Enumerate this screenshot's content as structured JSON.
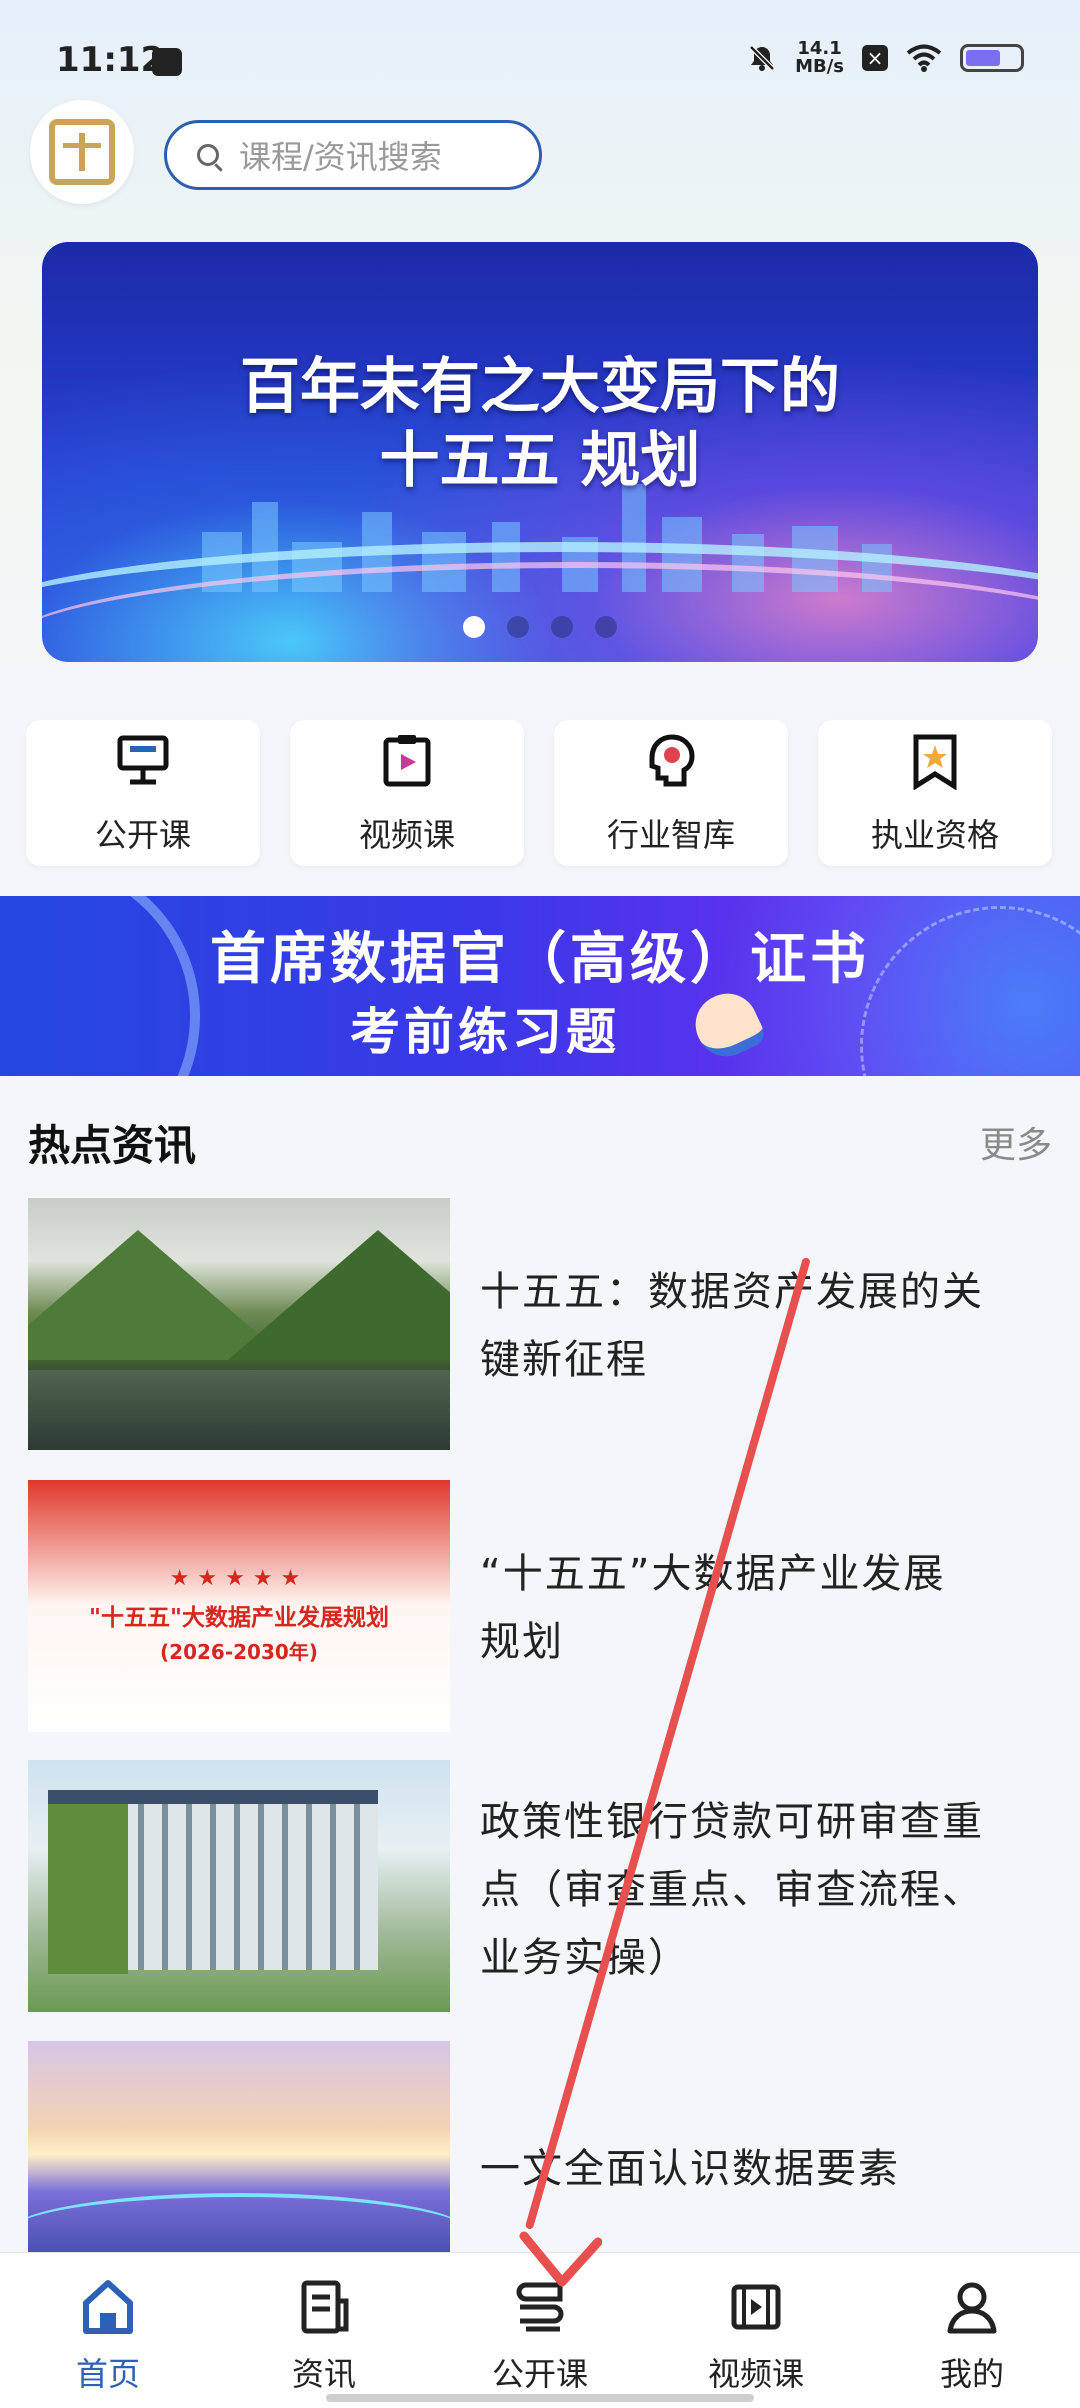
{
  "status_bar": {
    "time": "11:12",
    "net_speed_value": "14.1",
    "net_speed_unit": "MB/s"
  },
  "header": {
    "search_placeholder": "课程/资讯搜索"
  },
  "banner": {
    "line1": "百年未有之大变局下的",
    "line2": "十五五 规划",
    "dots": 4,
    "active_dot": 0
  },
  "categories": [
    {
      "label": "公开课",
      "icon": "monitor-icon"
    },
    {
      "label": "视频课",
      "icon": "video-clipboard-icon"
    },
    {
      "label": "行业智库",
      "icon": "brain-head-icon"
    },
    {
      "label": "执业资格",
      "icon": "star-bookmark-icon"
    }
  ],
  "promo": {
    "title": "首席数据官（高级）证书",
    "subtitle": "考前练习题"
  },
  "news_section": {
    "title": "热点资讯",
    "more": "更多",
    "items": [
      {
        "title_line1": "十五五：数据资产发展的关",
        "title_line2": "键新征程"
      },
      {
        "title_line1": "“十五五”大数据产业发展",
        "title_line2": "规划",
        "thumb_stars": "★★★★★",
        "thumb_text1": "\"十五五\"大数据产业发展规划",
        "thumb_text2": "(2026-2030年)"
      },
      {
        "title_line1": "政策性银行贷款可研审查重",
        "title_line2": "点（审查重点、审查流程、",
        "title_line3": "业务实操）"
      },
      {
        "title_line1": "一文全面认识数据要素"
      }
    ]
  },
  "bottom_nav": [
    {
      "label": "首页",
      "icon": "home-icon",
      "active": true
    },
    {
      "label": "资讯",
      "icon": "news-icon",
      "active": false
    },
    {
      "label": "公开课",
      "icon": "open-course-icon",
      "active": false
    },
    {
      "label": "视频课",
      "icon": "video-course-icon",
      "active": false
    },
    {
      "label": "我的",
      "icon": "profile-icon",
      "active": false
    }
  ],
  "colors": {
    "accent": "#2b62b8",
    "annotation_arrow": "#e8504f"
  }
}
